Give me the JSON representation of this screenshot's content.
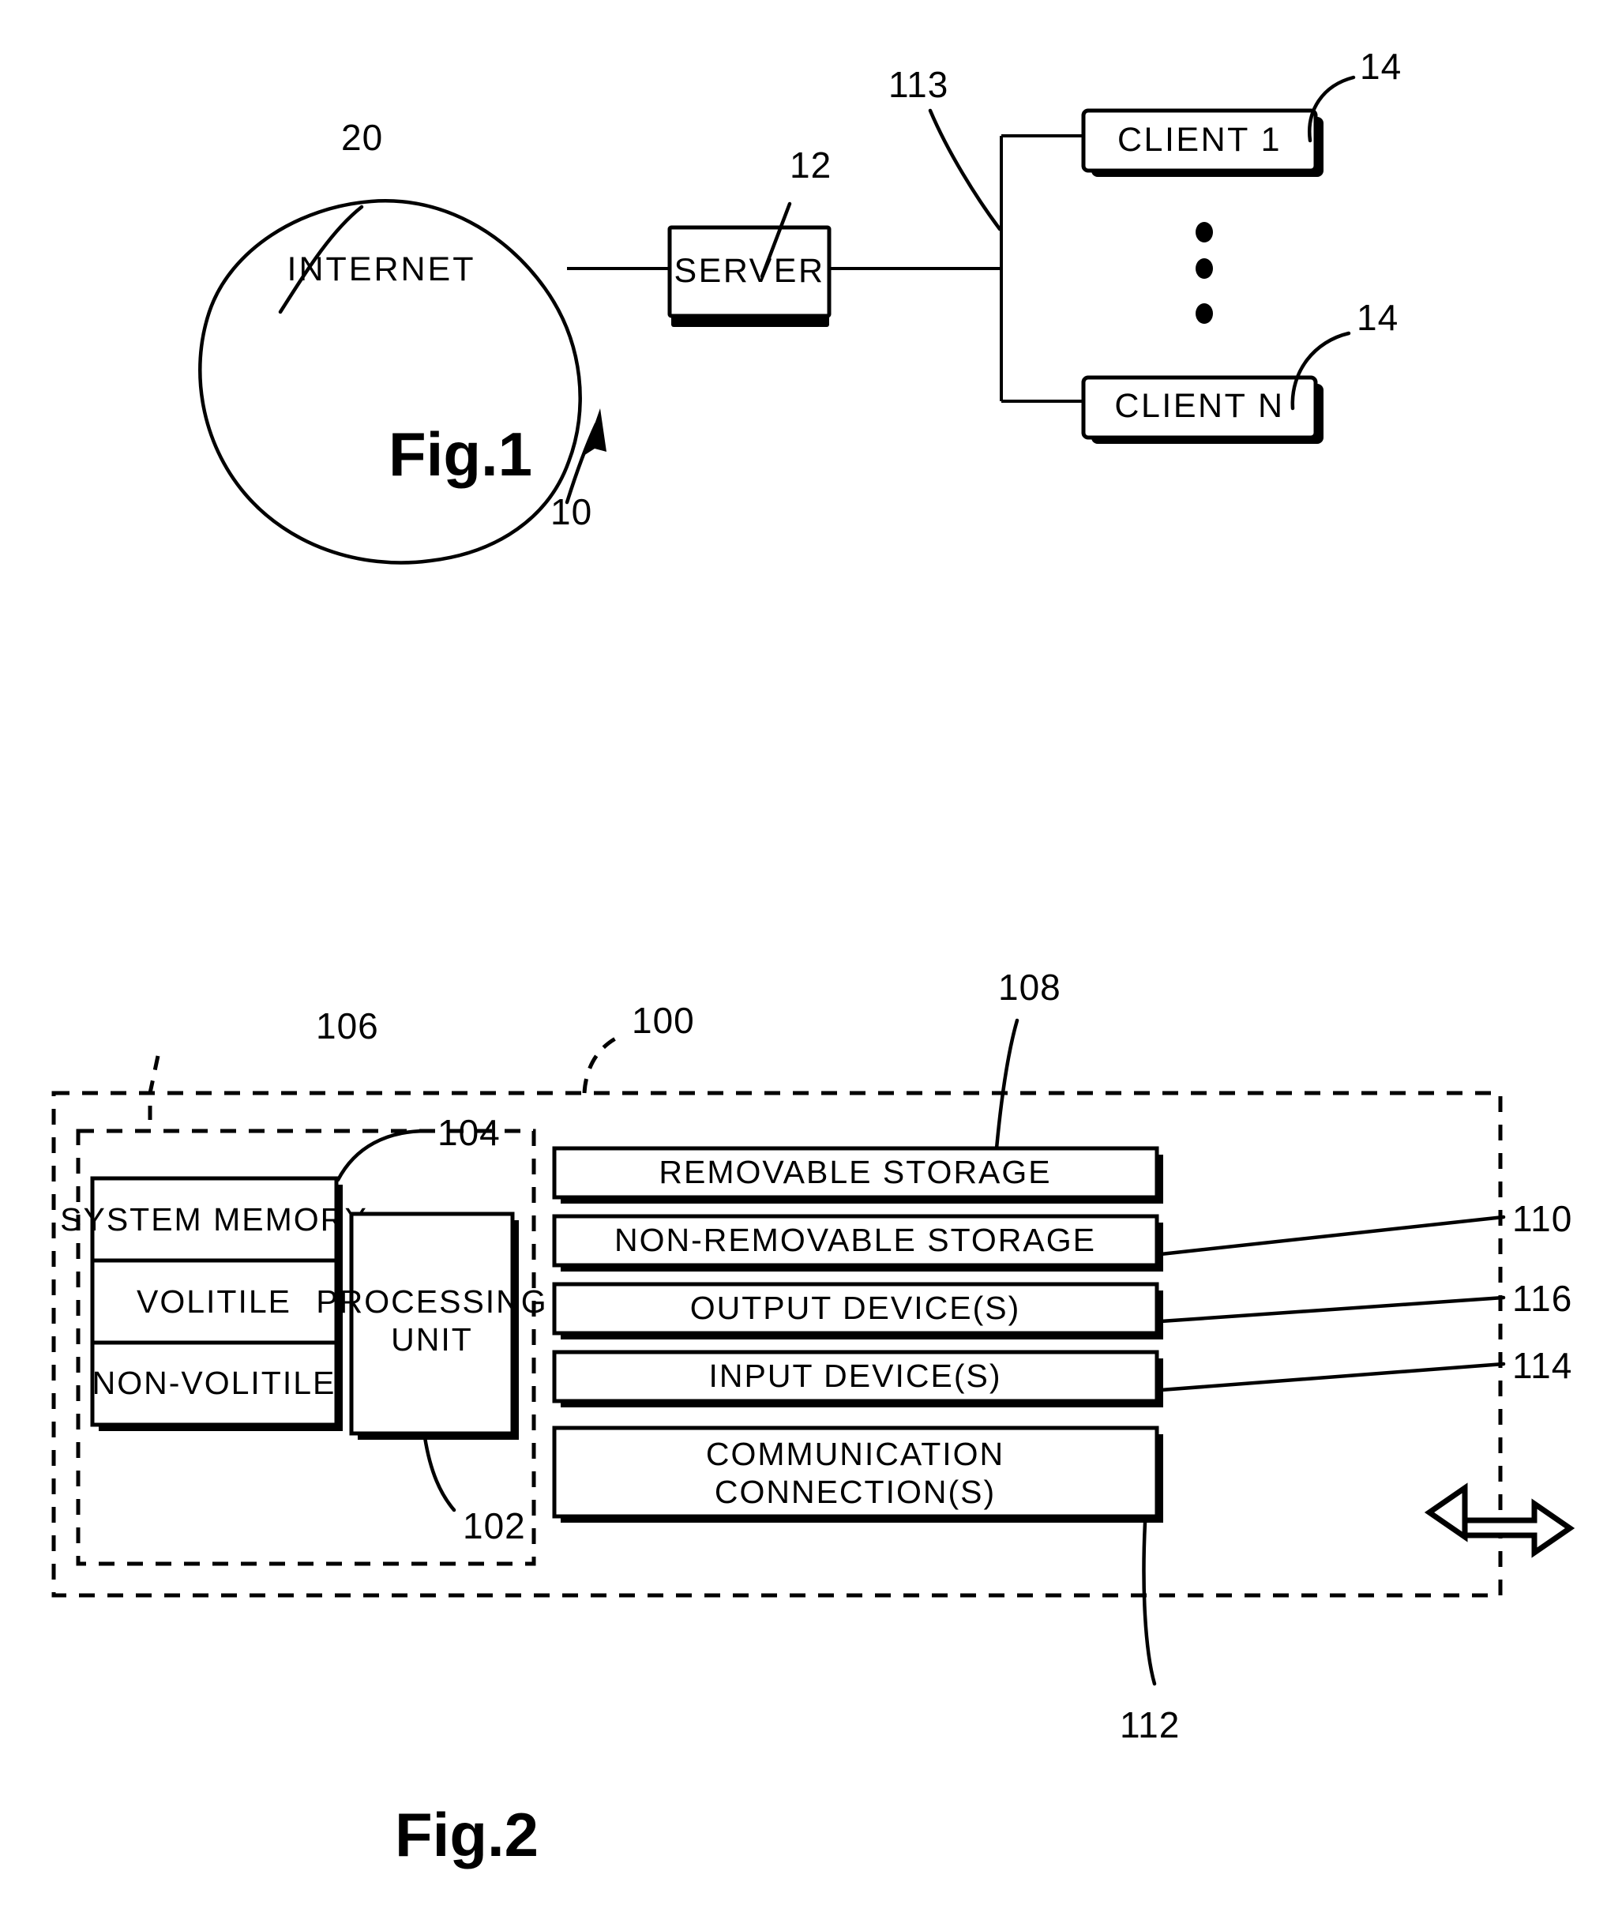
{
  "figures": [
    {
      "id": "fig1",
      "caption": "Fig.1",
      "system_ref": "10",
      "nodes": {
        "internet": {
          "label": "INTERNET",
          "ref": "20"
        },
        "server": {
          "label": "SERVER",
          "ref": "12"
        },
        "client_first": {
          "label": "CLIENT  1",
          "ref": "14"
        },
        "client_last": {
          "label": "CLIENT  N",
          "ref": "14"
        }
      },
      "bus_ref": "113",
      "ellipsis_dots": 3
    },
    {
      "id": "fig2",
      "caption": "Fig.2",
      "device_ref": "100",
      "memory_group_ref": "106",
      "nodes": {
        "system_memory": {
          "label": "SYSTEM  MEMORY",
          "ref": "104"
        },
        "volatile": {
          "label": "VOLITILE"
        },
        "non_volatile": {
          "label": "NON-VOLITILE"
        },
        "processing_unit": {
          "label": "PROCESSING UNIT",
          "line1": "PROCESSING",
          "line2": "UNIT",
          "ref": "102"
        },
        "removable_storage": {
          "label": "REMOVABLE  STORAGE",
          "ref": "108"
        },
        "non_removable_storage": {
          "label": "NON-REMOVABLE  STORAGE",
          "ref": "110"
        },
        "output_devices": {
          "label": "OUTPUT  DEVICE(S)",
          "ref": "116"
        },
        "input_devices": {
          "label": "INPUT  DEVICE(S)",
          "ref": "114"
        },
        "communication_connections": {
          "label": "COMMUNICATION CONNECTION(S)",
          "line1": "COMMUNICATION",
          "line2": "CONNECTION(S)",
          "ref": "112"
        }
      }
    }
  ],
  "colors": {
    "ink": "#000000",
    "paper": "#ffffff"
  }
}
